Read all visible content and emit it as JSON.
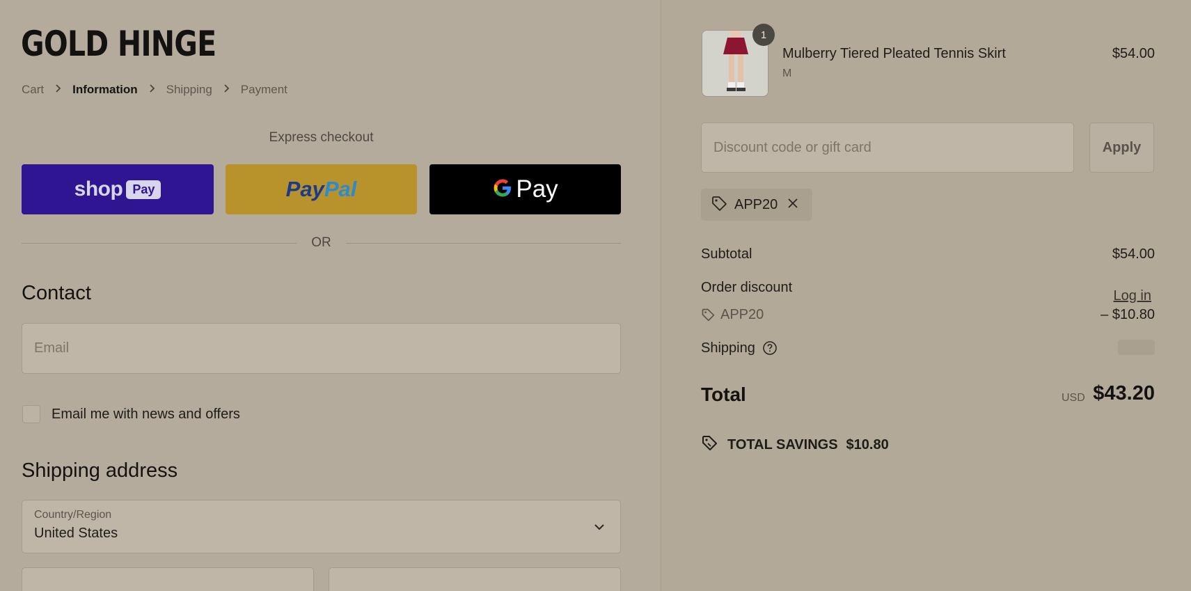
{
  "brand": {
    "logo": "GOLD HINGE"
  },
  "breadcrumb": {
    "items": [
      {
        "label": "Cart",
        "active": false
      },
      {
        "label": "Information",
        "active": true
      },
      {
        "label": "Shipping",
        "active": false
      },
      {
        "label": "Payment",
        "active": false
      }
    ]
  },
  "express": {
    "label": "Express checkout",
    "shop_pay": {
      "text": "shop",
      "badge": "Pay"
    },
    "paypal": {
      "part1": "Pay",
      "part2": "Pal"
    },
    "gpay": {
      "g": "G",
      "text": "Pay"
    }
  },
  "divider": {
    "text": "OR"
  },
  "contact": {
    "title": "Contact",
    "login": "Log in",
    "email_placeholder": "Email",
    "newsletter_label": "Email me with news and offers",
    "newsletter_checked": false
  },
  "shipping_address": {
    "title": "Shipping address",
    "country_label": "Country/Region",
    "country_value": "United States"
  },
  "order": {
    "item": {
      "name": "Mulberry Tiered Pleated Tennis Skirt",
      "variant": "M",
      "price": "$54.00",
      "quantity": "1"
    },
    "discount_placeholder": "Discount code or gift card",
    "apply_label": "Apply",
    "applied_code": "APP20",
    "subtotal_label": "Subtotal",
    "subtotal_value": "$54.00",
    "order_discount_label": "Order discount",
    "discount_code": "APP20",
    "discount_value": "– $10.80",
    "shipping_label": "Shipping",
    "total_label": "Total",
    "currency": "USD",
    "total_value": "$43.20",
    "savings_label": "TOTAL SAVINGS",
    "savings_value": "$10.80"
  },
  "colors": {
    "background": "#b5ab9c",
    "shop_pay": "#2f1592",
    "paypal": "#b8922a",
    "gpay": "#000000"
  }
}
